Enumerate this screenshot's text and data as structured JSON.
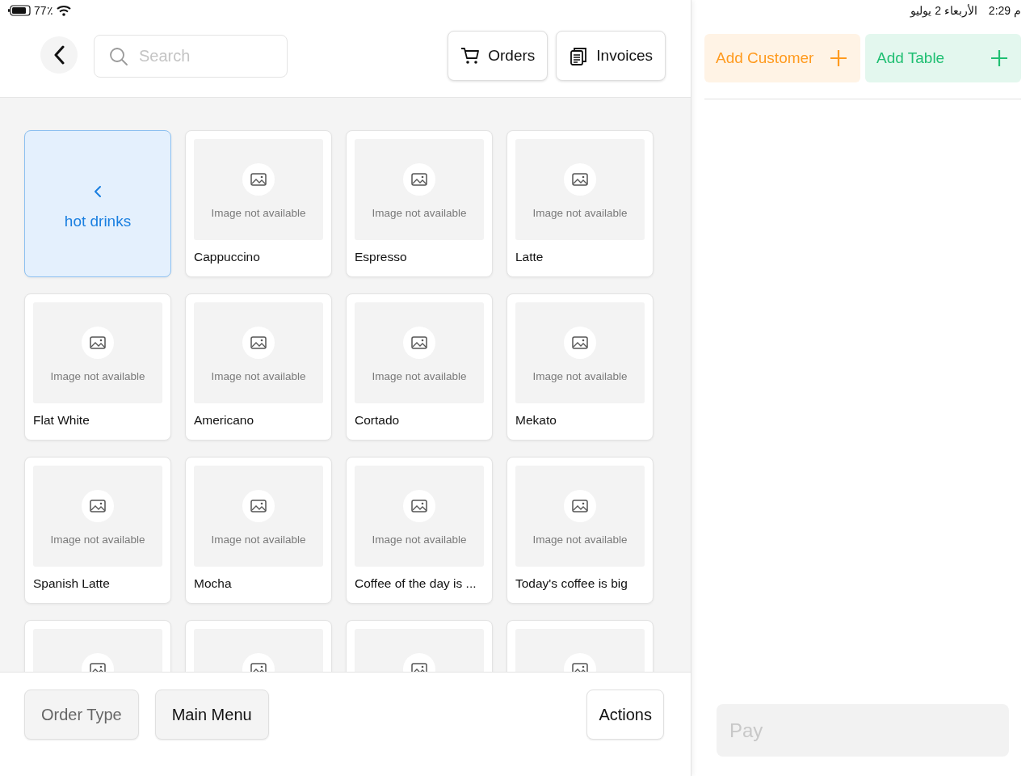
{
  "status_bar": {
    "battery": "77٪",
    "time": "2:29 م",
    "date": "الأربعاء 2 يوليو"
  },
  "header": {
    "search": {
      "placeholder": "Search"
    },
    "buttons": [
      {
        "kind": "orders",
        "label": "Orders"
      },
      {
        "kind": "invoices",
        "label": "Invoices"
      }
    ]
  },
  "items": [
    {
      "kind": "category",
      "label": "hot drinks",
      "selected": true
    },
    {
      "kind": "product",
      "name": "Cappuccino",
      "image_text": "Image not available"
    },
    {
      "kind": "product",
      "name": "Espresso",
      "image_text": "Image not available"
    },
    {
      "kind": "product",
      "name": "Latte",
      "image_text": "Image not available"
    },
    {
      "kind": "product",
      "name": "Flat White",
      "image_text": "Image not available"
    },
    {
      "kind": "product",
      "name": "Americano",
      "image_text": "Image not available"
    },
    {
      "kind": "product",
      "name": "Cortado",
      "image_text": "Image not available"
    },
    {
      "kind": "product",
      "name": "Mekato",
      "image_text": "Image not available"
    },
    {
      "kind": "product",
      "name": "Spanish Latte",
      "image_text": "Image not available"
    },
    {
      "kind": "product",
      "name": "Mocha",
      "image_text": "Image not available"
    },
    {
      "kind": "product",
      "name": "Coffee of the day is ...",
      "image_text": "Image not available"
    },
    {
      "kind": "product",
      "name": "Today's coffee is big",
      "image_text": "Image not available"
    },
    {
      "kind": "product"
    },
    {
      "kind": "product"
    },
    {
      "kind": "product"
    },
    {
      "kind": "product"
    }
  ],
  "footer": {
    "buttons": [
      {
        "label": "Order Type",
        "disabled": true
      },
      {
        "label": "Main Menu",
        "disabled": false
      }
    ],
    "actions": "Actions"
  },
  "order_panel": {
    "buttons": [
      {
        "kind": "customer",
        "label": "Add Customer"
      },
      {
        "kind": "table",
        "label": "Add Table"
      }
    ],
    "pay": {
      "label": "Pay",
      "disabled": true
    }
  }
}
